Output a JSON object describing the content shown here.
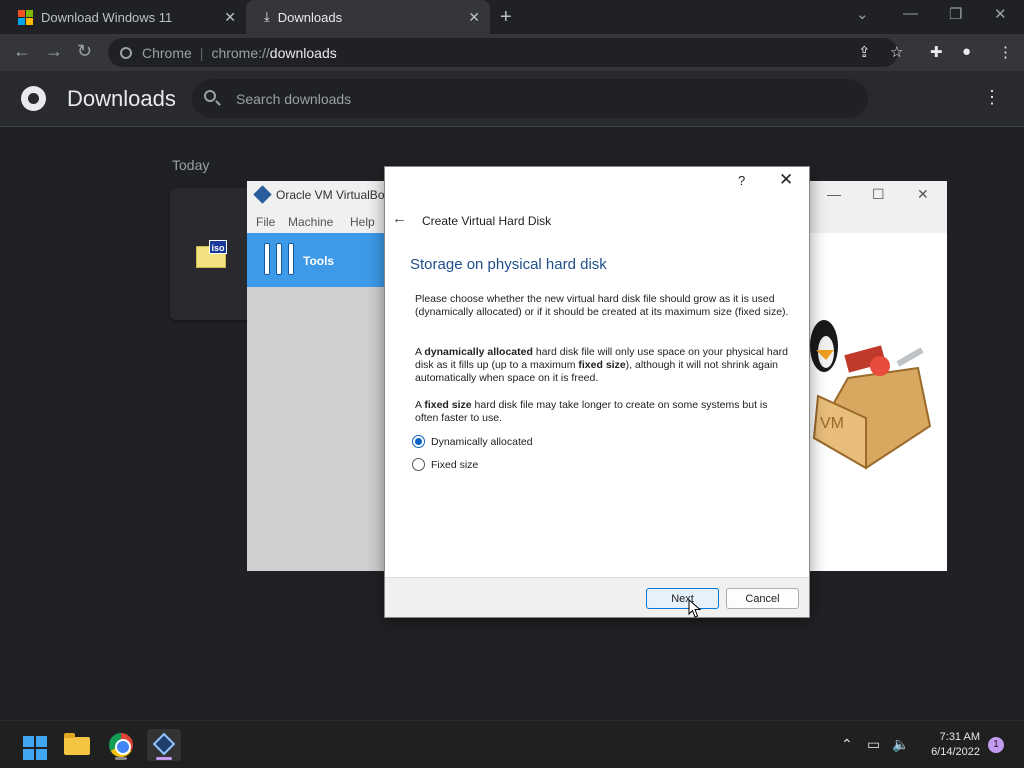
{
  "browser": {
    "tabs": [
      {
        "title": "Download Windows 11",
        "icon": "windows-logo-icon"
      },
      {
        "title": "Downloads",
        "icon": "download-icon"
      }
    ],
    "omnibox": {
      "chip": "Chrome",
      "scheme": "chrome://",
      "path": "downloads"
    }
  },
  "downloads": {
    "title": "Downloads",
    "search_placeholder": "Search downloads",
    "date_group": "Today",
    "item_icon": "iso-file-icon",
    "item_icon_text": "iso"
  },
  "virtualbox": {
    "title": "Oracle VM VirtualBo",
    "menu": [
      "File",
      "Machine",
      "Help"
    ],
    "tools_label": "Tools"
  },
  "dialog": {
    "help": "?",
    "title": "Create Virtual Hard Disk",
    "heading": "Storage on physical hard disk",
    "paragraph1": "Please choose whether the new virtual hard disk file should grow as it is used (dynamically allocated) or if it should be created at its maximum size (fixed size).",
    "paragraph2": {
      "pre": "A ",
      "bold1": "dynamically allocated",
      "mid": " hard disk file will only use space on your physical hard disk as it fills up (up to a maximum ",
      "bold2": "fixed size",
      "post": "), although it will not shrink again automatically when space on it is freed."
    },
    "paragraph3": {
      "pre": "A ",
      "bold": "fixed size",
      "post": " hard disk file may take longer to create on some systems but is often faster to use."
    },
    "options": [
      {
        "label": "Dynamically allocated",
        "selected": true
      },
      {
        "label": "Fixed size",
        "selected": false
      }
    ],
    "next_label": "Next",
    "cancel_label": "Cancel"
  },
  "taskbar": {
    "time": "7:31 AM",
    "date": "6/14/2022",
    "notification_count": "1",
    "apps": [
      "start-icon",
      "file-explorer-icon",
      "chrome-icon",
      "virtualbox-icon"
    ]
  },
  "colors": {
    "accent_blue": "#0b62c4",
    "dialog_heading": "#1f4e8c",
    "vbox_selected": "#3d9ae8",
    "chrome_dark": "#202124"
  }
}
